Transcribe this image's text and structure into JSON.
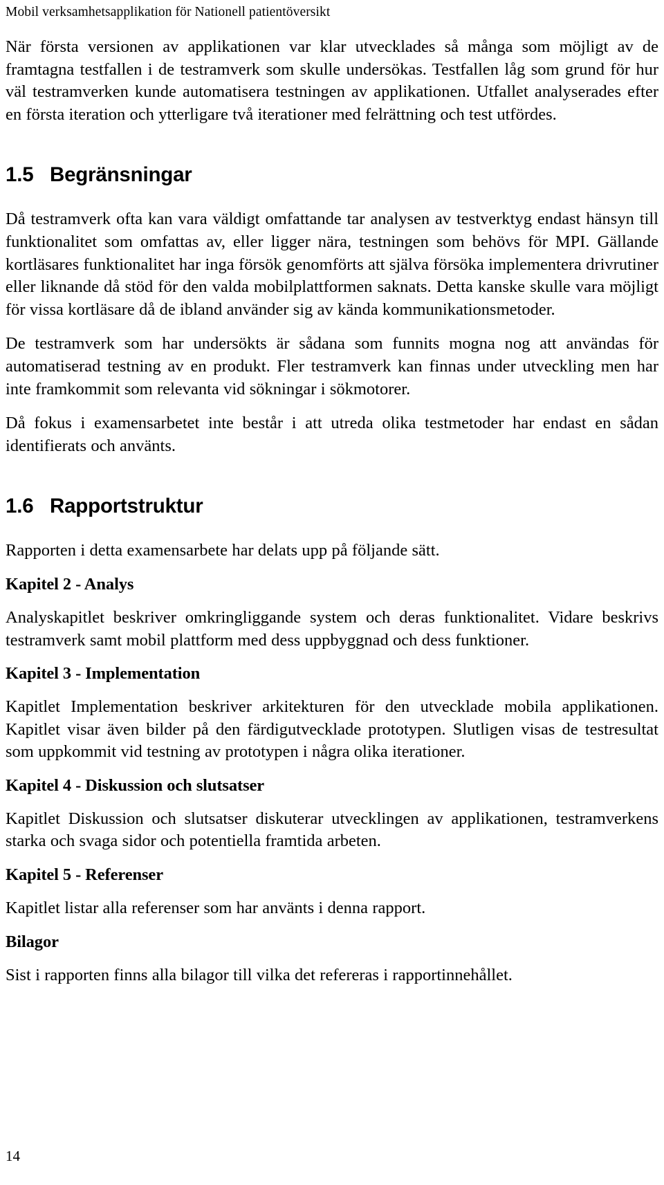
{
  "document": {
    "running_header": "Mobil verksamhetsapplikation för Nationell patientöversikt",
    "page_number": "14"
  },
  "intro": {
    "paragraph": "När första versionen av applikationen var klar utvecklades så många som möjligt av de framtagna testfallen i de testramverk som skulle undersökas. Testfallen låg som grund för hur väl testramverken kunde automatisera testningen av applikationen. Utfallet analyserades efter en första iteration och ytterligare två iterationer med felrättning och test utfördes."
  },
  "sections": [
    {
      "number": "1.5",
      "title": "Begränsningar",
      "paragraphs": [
        "Då testramverk ofta kan vara väldigt omfattande tar analysen av testverktyg endast hänsyn till funktionalitet som omfattas av, eller ligger nära, testningen som behövs för MPI. Gällande kortläsares funktionalitet har inga försök genomförts att själva försöka implementera drivrutiner eller liknande då stöd för den valda mobilplattformen saknats. Detta kanske skulle vara möjligt för vissa kortläsare då de ibland använder sig av kända kommunikationsmetoder.",
        "De testramverk som har undersökts är sådana som funnits mogna nog att användas för automatiserad testning av en produkt. Fler testramverk kan finnas under utveckling men har inte framkommit som relevanta vid sökningar i sökmotorer.",
        "Då fokus i examensarbetet inte består i att utreda olika testmetoder har endast en sådan identifierats och använts."
      ]
    },
    {
      "number": "1.6",
      "title": "Rapportstruktur",
      "intro_paragraph": "Rapporten i detta examensarbete har delats upp på följande sätt.",
      "chapters": [
        {
          "heading": "Kapitel 2 - Analys",
          "text": "Analyskapitlet beskriver omkringliggande system och deras funktionalitet. Vidare beskrivs testramverk samt mobil plattform med dess uppbyggnad och dess funktioner."
        },
        {
          "heading": "Kapitel 3 - Implementation",
          "text": "Kapitlet Implementation beskriver arkitekturen för den utvecklade mobila applikationen. Kapitlet visar även bilder på den färdigutvecklade prototypen. Slutligen visas de testresultat som uppkommit vid testning av prototypen i några olika iterationer."
        },
        {
          "heading": "Kapitel 4 - Diskussion och slutsatser",
          "text": "Kapitlet Diskussion och slutsatser diskuterar utvecklingen av applikationen, testramverkens starka och svaga sidor och potentiella framtida arbeten."
        },
        {
          "heading": "Kapitel 5 - Referenser",
          "text": "Kapitlet listar alla referenser som har använts i denna rapport."
        },
        {
          "heading": "Bilagor",
          "text": "Sist i rapporten finns alla bilagor till vilka det refereras i rapportinnehållet."
        }
      ]
    }
  ]
}
